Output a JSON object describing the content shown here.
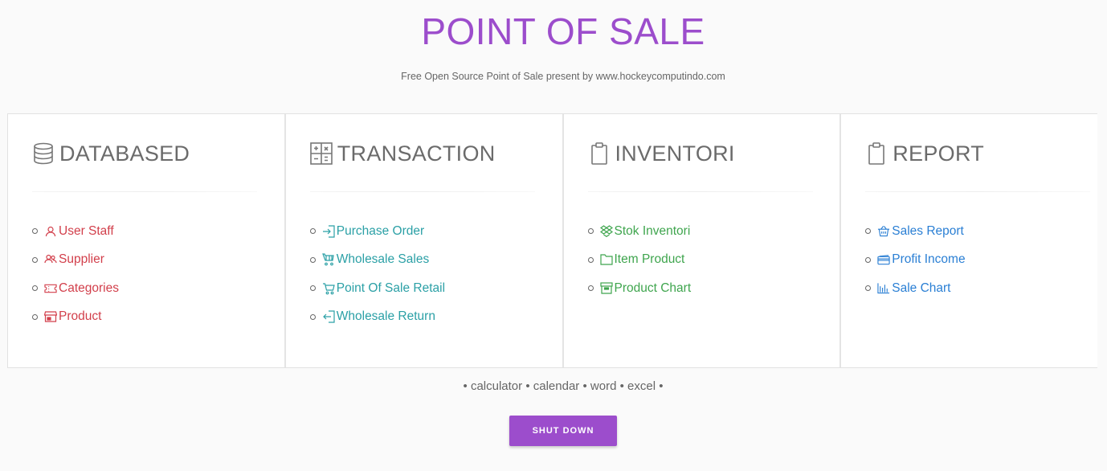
{
  "header": {
    "title": "POINT OF SALE",
    "subtitle": "Free Open Source Point of Sale present by www.hockeycomputindo.com"
  },
  "colors": {
    "accent": "#9c4dcc",
    "databased": "#d23f4b",
    "transaction": "#2ba0a6",
    "inventori": "#3fa54e",
    "report": "#2a7fd4"
  },
  "panels": [
    {
      "title": "DATABASED",
      "icon": "database-icon",
      "items": [
        {
          "label": "User Staff",
          "icon": "user-icon"
        },
        {
          "label": "Supplier",
          "icon": "users-icon"
        },
        {
          "label": "Categories",
          "icon": "ticket-icon"
        },
        {
          "label": "Product",
          "icon": "store-icon"
        }
      ]
    },
    {
      "title": "TRANSACTION",
      "icon": "calculator-icon",
      "items": [
        {
          "label": "Purchase Order",
          "icon": "login-icon"
        },
        {
          "label": "Wholesale Sales",
          "icon": "trolley-icon"
        },
        {
          "label": "Point Of Sale Retail",
          "icon": "cart-icon"
        },
        {
          "label": "Wholesale Return",
          "icon": "logout-icon"
        }
      ]
    },
    {
      "title": "INVENTORI",
      "icon": "clipboard-icon",
      "items": [
        {
          "label": "Stok Inventori",
          "icon": "dropbox-icon"
        },
        {
          "label": "Item Product",
          "icon": "folder-icon"
        },
        {
          "label": "Product Chart",
          "icon": "archive-icon"
        }
      ]
    },
    {
      "title": "REPORT",
      "icon": "clipboard-icon",
      "items": [
        {
          "label": "Sales Report",
          "icon": "basket-icon"
        },
        {
          "label": "Profit Income",
          "icon": "credit-card-icon"
        },
        {
          "label": "Sale Chart",
          "icon": "bar-chart-icon"
        }
      ]
    }
  ],
  "tools": {
    "sep": "•",
    "items": [
      "calculator",
      "calendar",
      "word",
      "excel"
    ]
  },
  "shutdown_label": "SHUT DOWN"
}
